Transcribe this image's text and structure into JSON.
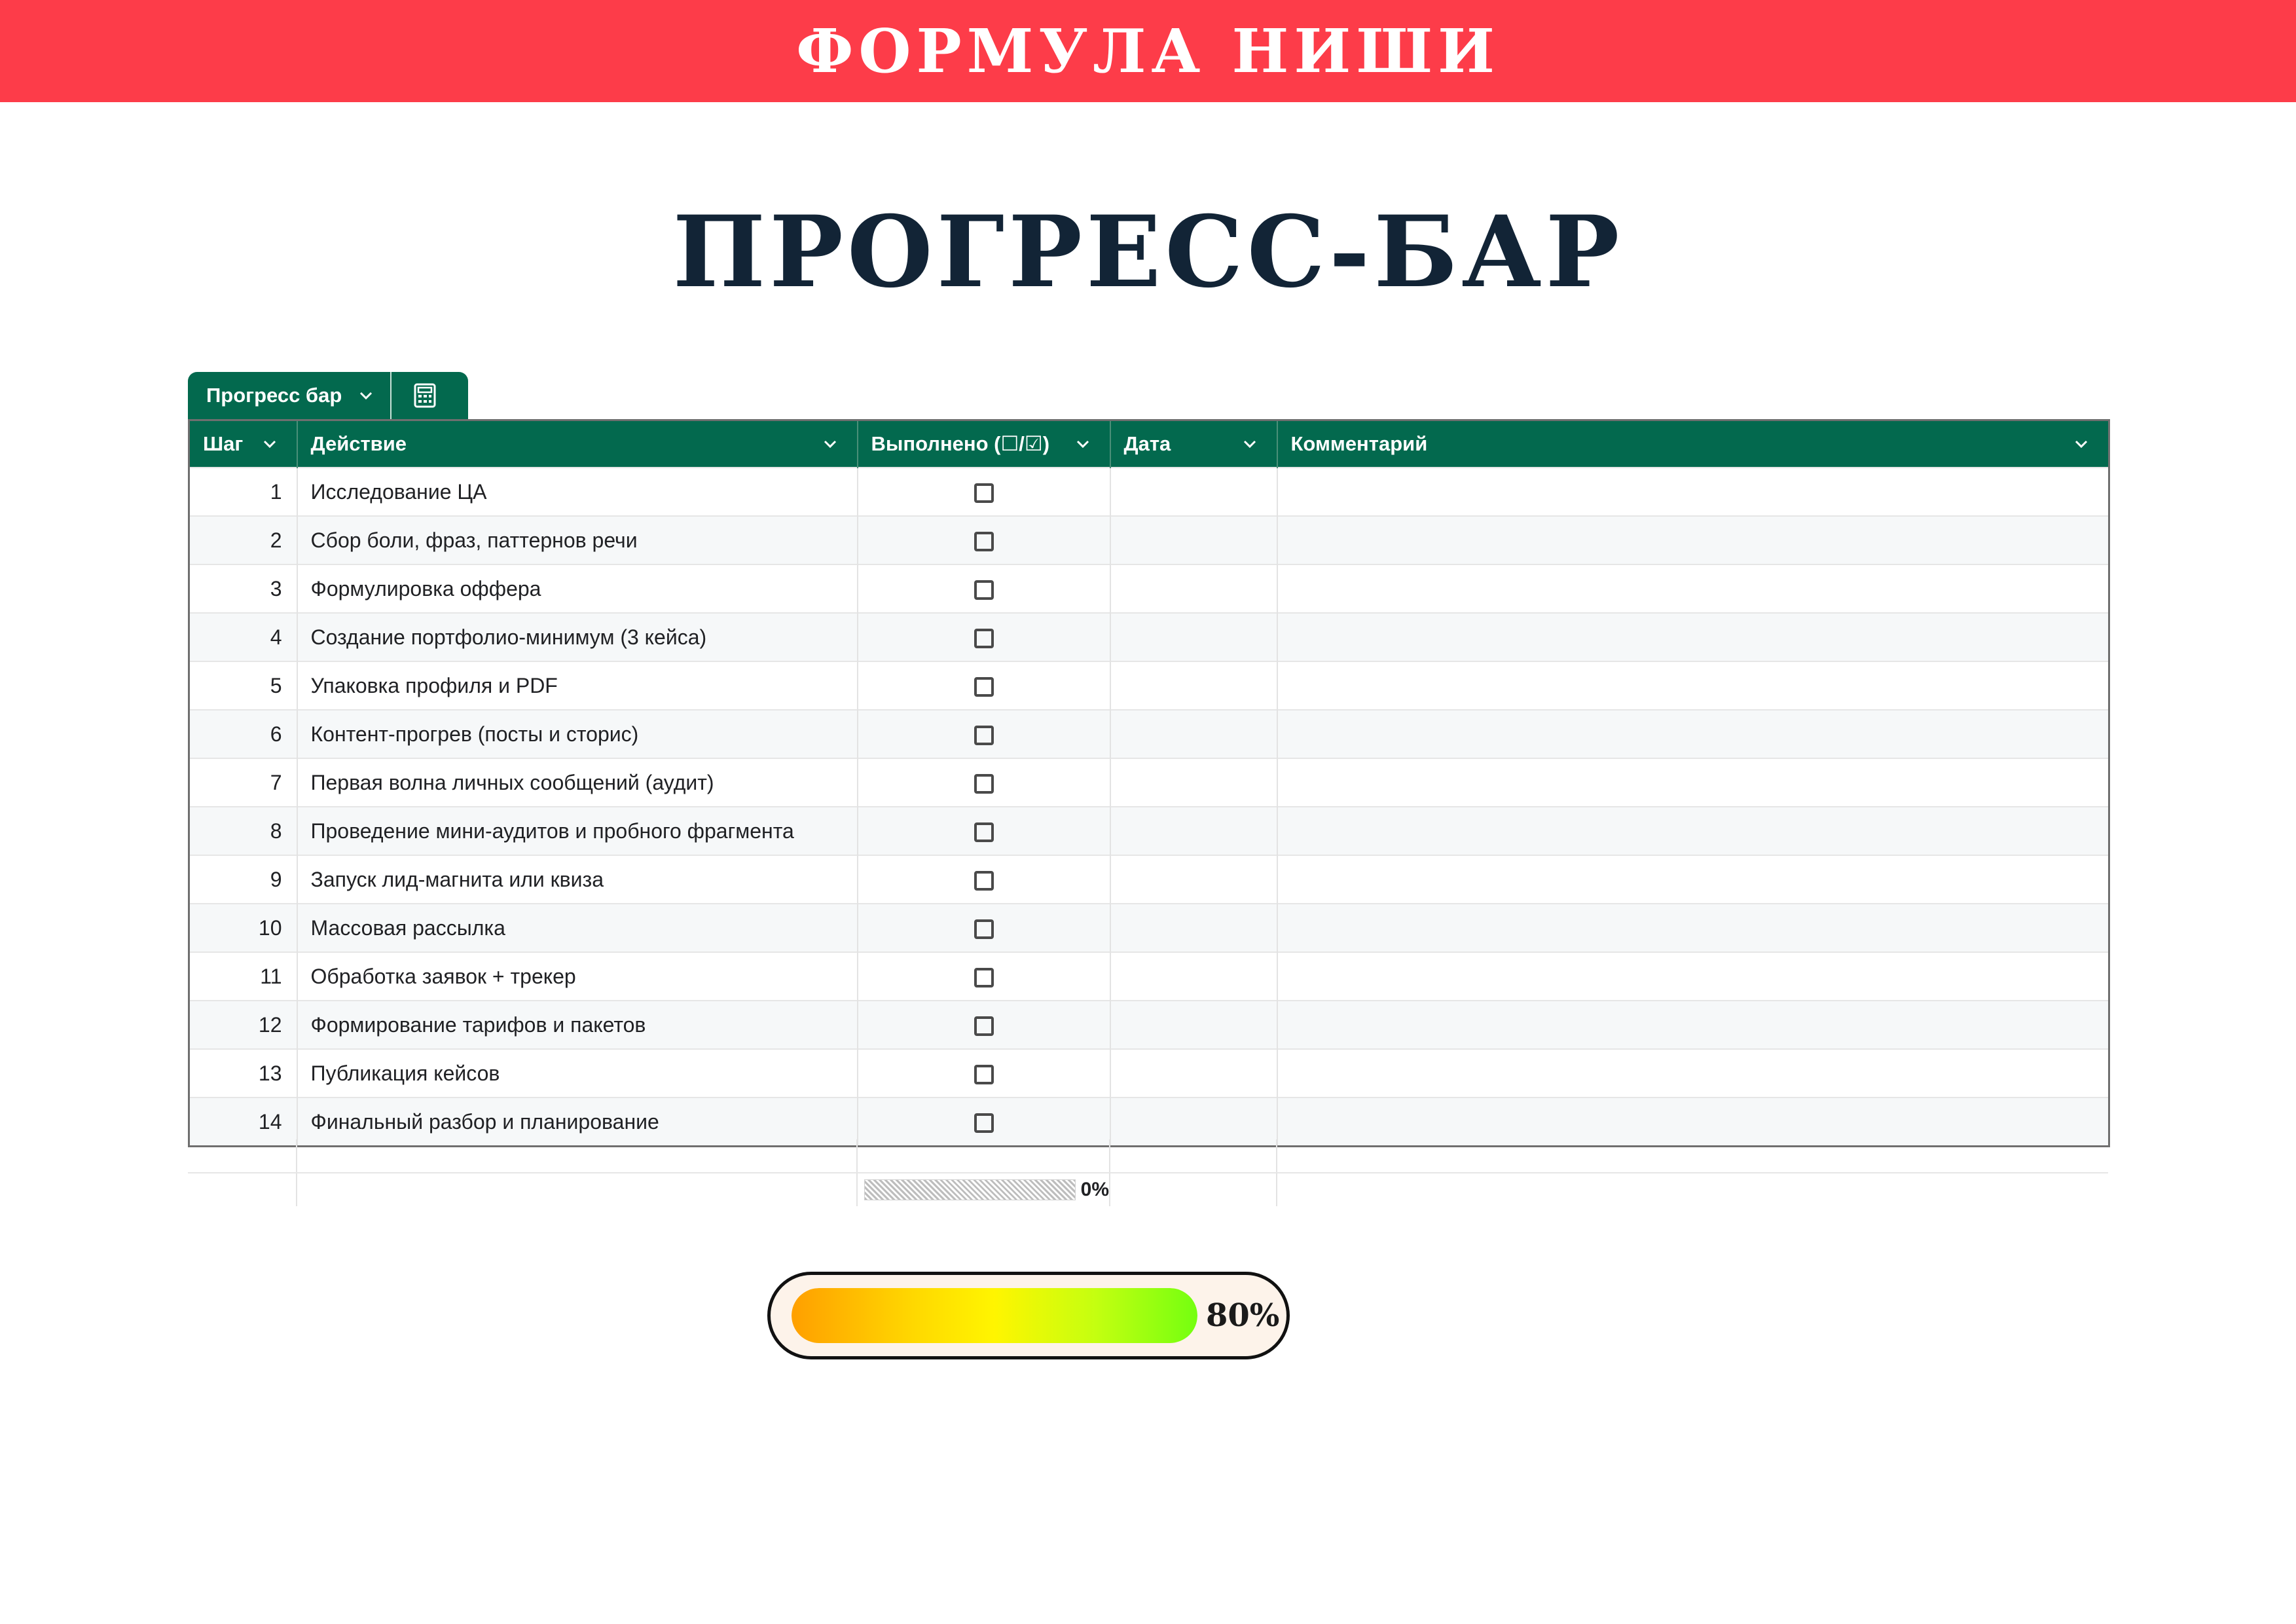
{
  "banner": {
    "title": "ФОРМУЛА НИШИ"
  },
  "page_title": "ПРОГРЕСС-БАР",
  "sheet_tab": {
    "label": "Прогресс бар"
  },
  "table": {
    "columns": [
      {
        "label": "Шаг"
      },
      {
        "label": "Действие"
      },
      {
        "label": "Выполнено (☐/☑)"
      },
      {
        "label": "Дата"
      },
      {
        "label": "Комментарий"
      }
    ],
    "rows": [
      {
        "step": "1",
        "action": "Исследование ЦА",
        "done": false
      },
      {
        "step": "2",
        "action": "Сбор боли, фраз, паттернов речи",
        "done": false
      },
      {
        "step": "3",
        "action": "Формулировка оффера",
        "done": false
      },
      {
        "step": "4",
        "action": "Создание портфолио-минимум (3 кейса)",
        "done": false
      },
      {
        "step": "5",
        "action": "Упаковка профиля и PDF",
        "done": false
      },
      {
        "step": "6",
        "action": "Контент-прогрев (посты и сторис)",
        "done": false
      },
      {
        "step": "7",
        "action": "Первая волна личных сообщений (аудит)",
        "done": false
      },
      {
        "step": "8",
        "action": "Проведение мини-аудитов и пробного фрагмента",
        "done": false
      },
      {
        "step": "9",
        "action": "Запуск лид-магнита или квиза",
        "done": false
      },
      {
        "step": "10",
        "action": "Массовая рассылка",
        "done": false
      },
      {
        "step": "11",
        "action": "Обработка заявок + трекер",
        "done": false
      },
      {
        "step": "12",
        "action": "Формирование тарифов и пакетов",
        "done": false
      },
      {
        "step": "13",
        "action": "Публикация кейсов",
        "done": false
      },
      {
        "step": "14",
        "action": "Финальный разбор и планирование",
        "done": false
      }
    ]
  },
  "sheet_progress": {
    "label": "0%",
    "value": 0
  },
  "progress_bar": {
    "label": "80%",
    "value": 0.8
  },
  "colors": {
    "banner": "#fd3c49",
    "header_green": "#03694e",
    "title_navy": "#122436"
  },
  "icons": {
    "tab_icon": "calculator-icon",
    "dropdown": "chevron-down-icon",
    "checkbox": "checkbox-unchecked-icon"
  }
}
